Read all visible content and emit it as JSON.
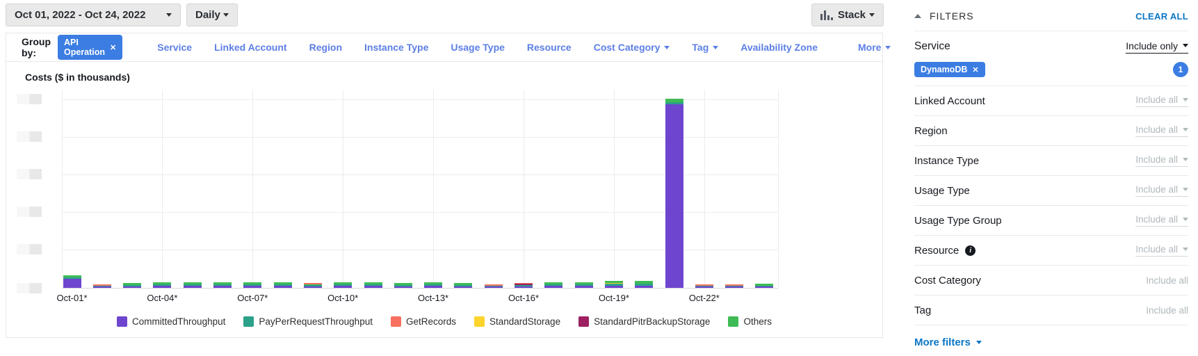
{
  "toolbar": {
    "date_range": "Oct 01, 2022 - Oct 24, 2022",
    "granularity": "Daily",
    "chart_style": "Stack"
  },
  "group_by": {
    "label": "Group by:",
    "active_chip": "API Operation",
    "options": [
      {
        "label": "Service",
        "caret": false
      },
      {
        "label": "Linked Account",
        "caret": false
      },
      {
        "label": "Region",
        "caret": false
      },
      {
        "label": "Instance Type",
        "caret": false
      },
      {
        "label": "Usage Type",
        "caret": false
      },
      {
        "label": "Resource",
        "caret": false
      },
      {
        "label": "Cost Category",
        "caret": true
      },
      {
        "label": "Tag",
        "caret": true
      },
      {
        "label": "Availability Zone",
        "caret": false
      },
      {
        "label": "More",
        "caret": true
      }
    ]
  },
  "chart_data": {
    "type": "bar",
    "stacked": true,
    "title": "Costs ($ in thousands)",
    "xlabel": "",
    "ylabel": "Costs ($ in thousands)",
    "y_axis_note": "y-axis tick labels are redacted (gray boxes) in the screenshot; 6 ticks visible",
    "grid": true,
    "legend_position": "bottom",
    "series": [
      {
        "name": "CommittedThroughput",
        "color": "#6e45cf"
      },
      {
        "name": "PayPerRequestThroughput",
        "color": "#2ba189"
      },
      {
        "name": "GetRecords",
        "color": "#f7705f"
      },
      {
        "name": "StandardStorage",
        "color": "#fcd42c"
      },
      {
        "name": "StandardPitrBackupStorage",
        "color": "#9d2161"
      },
      {
        "name": "Others",
        "color": "#3fbb55"
      }
    ],
    "x_tick_labels": [
      "Oct-01*",
      "Oct-04*",
      "Oct-07*",
      "Oct-10*",
      "Oct-13*",
      "Oct-16*",
      "Oct-19*",
      "Oct-22*"
    ],
    "bar_unit": "pixel heights estimated from screenshot (axis values redacted)",
    "bars": [
      {
        "d": "Oct-01",
        "s": [
          [
            0,
            13
          ],
          [
            1,
            2
          ],
          [
            5,
            3
          ]
        ]
      },
      {
        "d": "Oct-02",
        "s": [
          [
            0,
            2
          ],
          [
            1,
            1
          ],
          [
            2,
            2
          ]
        ]
      },
      {
        "d": "Oct-03",
        "s": [
          [
            0,
            2
          ],
          [
            1,
            2
          ],
          [
            5,
            3
          ]
        ]
      },
      {
        "d": "Oct-04",
        "s": [
          [
            0,
            3
          ],
          [
            1,
            2
          ],
          [
            5,
            3
          ]
        ]
      },
      {
        "d": "Oct-05",
        "s": [
          [
            0,
            3
          ],
          [
            1,
            2
          ],
          [
            5,
            3
          ]
        ]
      },
      {
        "d": "Oct-06",
        "s": [
          [
            0,
            3
          ],
          [
            1,
            2
          ],
          [
            5,
            3
          ]
        ]
      },
      {
        "d": "Oct-07",
        "s": [
          [
            0,
            3
          ],
          [
            1,
            2
          ],
          [
            5,
            3
          ]
        ]
      },
      {
        "d": "Oct-08",
        "s": [
          [
            0,
            3
          ],
          [
            1,
            2
          ],
          [
            5,
            3
          ]
        ]
      },
      {
        "d": "Oct-09",
        "s": [
          [
            0,
            2
          ],
          [
            1,
            2
          ],
          [
            5,
            1
          ],
          [
            2,
            2
          ]
        ]
      },
      {
        "d": "Oct-10",
        "s": [
          [
            0,
            3
          ],
          [
            1,
            2
          ],
          [
            5,
            3
          ]
        ]
      },
      {
        "d": "Oct-11",
        "s": [
          [
            0,
            3
          ],
          [
            1,
            2
          ],
          [
            5,
            3
          ]
        ]
      },
      {
        "d": "Oct-12",
        "s": [
          [
            0,
            2
          ],
          [
            1,
            2
          ],
          [
            5,
            3
          ]
        ]
      },
      {
        "d": "Oct-13",
        "s": [
          [
            0,
            3
          ],
          [
            1,
            2
          ],
          [
            5,
            3
          ]
        ]
      },
      {
        "d": "Oct-14",
        "s": [
          [
            0,
            2
          ],
          [
            1,
            2
          ],
          [
            5,
            3
          ]
        ]
      },
      {
        "d": "Oct-15",
        "s": [
          [
            0,
            2
          ],
          [
            1,
            1
          ],
          [
            2,
            2
          ]
        ]
      },
      {
        "d": "Oct-16",
        "s": [
          [
            0,
            2
          ],
          [
            1,
            2
          ],
          [
            4,
            2
          ],
          [
            2,
            1
          ]
        ]
      },
      {
        "d": "Oct-17",
        "s": [
          [
            0,
            3
          ],
          [
            1,
            2
          ],
          [
            5,
            3
          ]
        ]
      },
      {
        "d": "Oct-18",
        "s": [
          [
            0,
            3
          ],
          [
            1,
            2
          ],
          [
            5,
            3
          ]
        ]
      },
      {
        "d": "Oct-19",
        "s": [
          [
            0,
            3
          ],
          [
            1,
            3
          ],
          [
            3,
            1
          ],
          [
            5,
            3
          ]
        ]
      },
      {
        "d": "Oct-20",
        "s": [
          [
            0,
            3
          ],
          [
            1,
            3
          ],
          [
            5,
            4
          ]
        ]
      },
      {
        "d": "Oct-21",
        "s": [
          [
            0,
            264
          ],
          [
            1,
            3
          ],
          [
            5,
            5
          ]
        ]
      },
      {
        "d": "Oct-22",
        "s": [
          [
            0,
            2
          ],
          [
            1,
            1
          ],
          [
            2,
            2
          ]
        ]
      },
      {
        "d": "Oct-23",
        "s": [
          [
            0,
            2
          ],
          [
            1,
            1
          ],
          [
            2,
            2
          ]
        ]
      },
      {
        "d": "Oct-24",
        "s": [
          [
            0,
            2
          ],
          [
            1,
            1
          ],
          [
            5,
            3
          ]
        ]
      }
    ]
  },
  "filters": {
    "title": "FILTERS",
    "clear_all": "CLEAR ALL",
    "service": {
      "label": "Service",
      "mode": "Include only",
      "chip": "DynamoDB",
      "count": "1"
    },
    "rows": [
      {
        "label": "Linked Account",
        "value": "Include all",
        "dropdown": true,
        "info": false
      },
      {
        "label": "Region",
        "value": "Include all",
        "dropdown": true,
        "info": false
      },
      {
        "label": "Instance Type",
        "value": "Include all",
        "dropdown": true,
        "info": false
      },
      {
        "label": "Usage Type",
        "value": "Include all",
        "dropdown": true,
        "info": false
      },
      {
        "label": "Usage Type Group",
        "value": "Include all",
        "dropdown": true,
        "info": false
      },
      {
        "label": "Resource",
        "value": "Include all",
        "dropdown": true,
        "info": true
      },
      {
        "label": "Cost Category",
        "value": "Include all",
        "dropdown": false,
        "info": false
      },
      {
        "label": "Tag",
        "value": "Include all",
        "dropdown": false,
        "info": false
      }
    ],
    "more_filters": "More filters"
  },
  "colors": {
    "chip_blue": "#3b7de2",
    "link_blue": "#5c7fe6",
    "action_blue": "#0a76c4",
    "muted_gray": "#b0b8bc"
  }
}
